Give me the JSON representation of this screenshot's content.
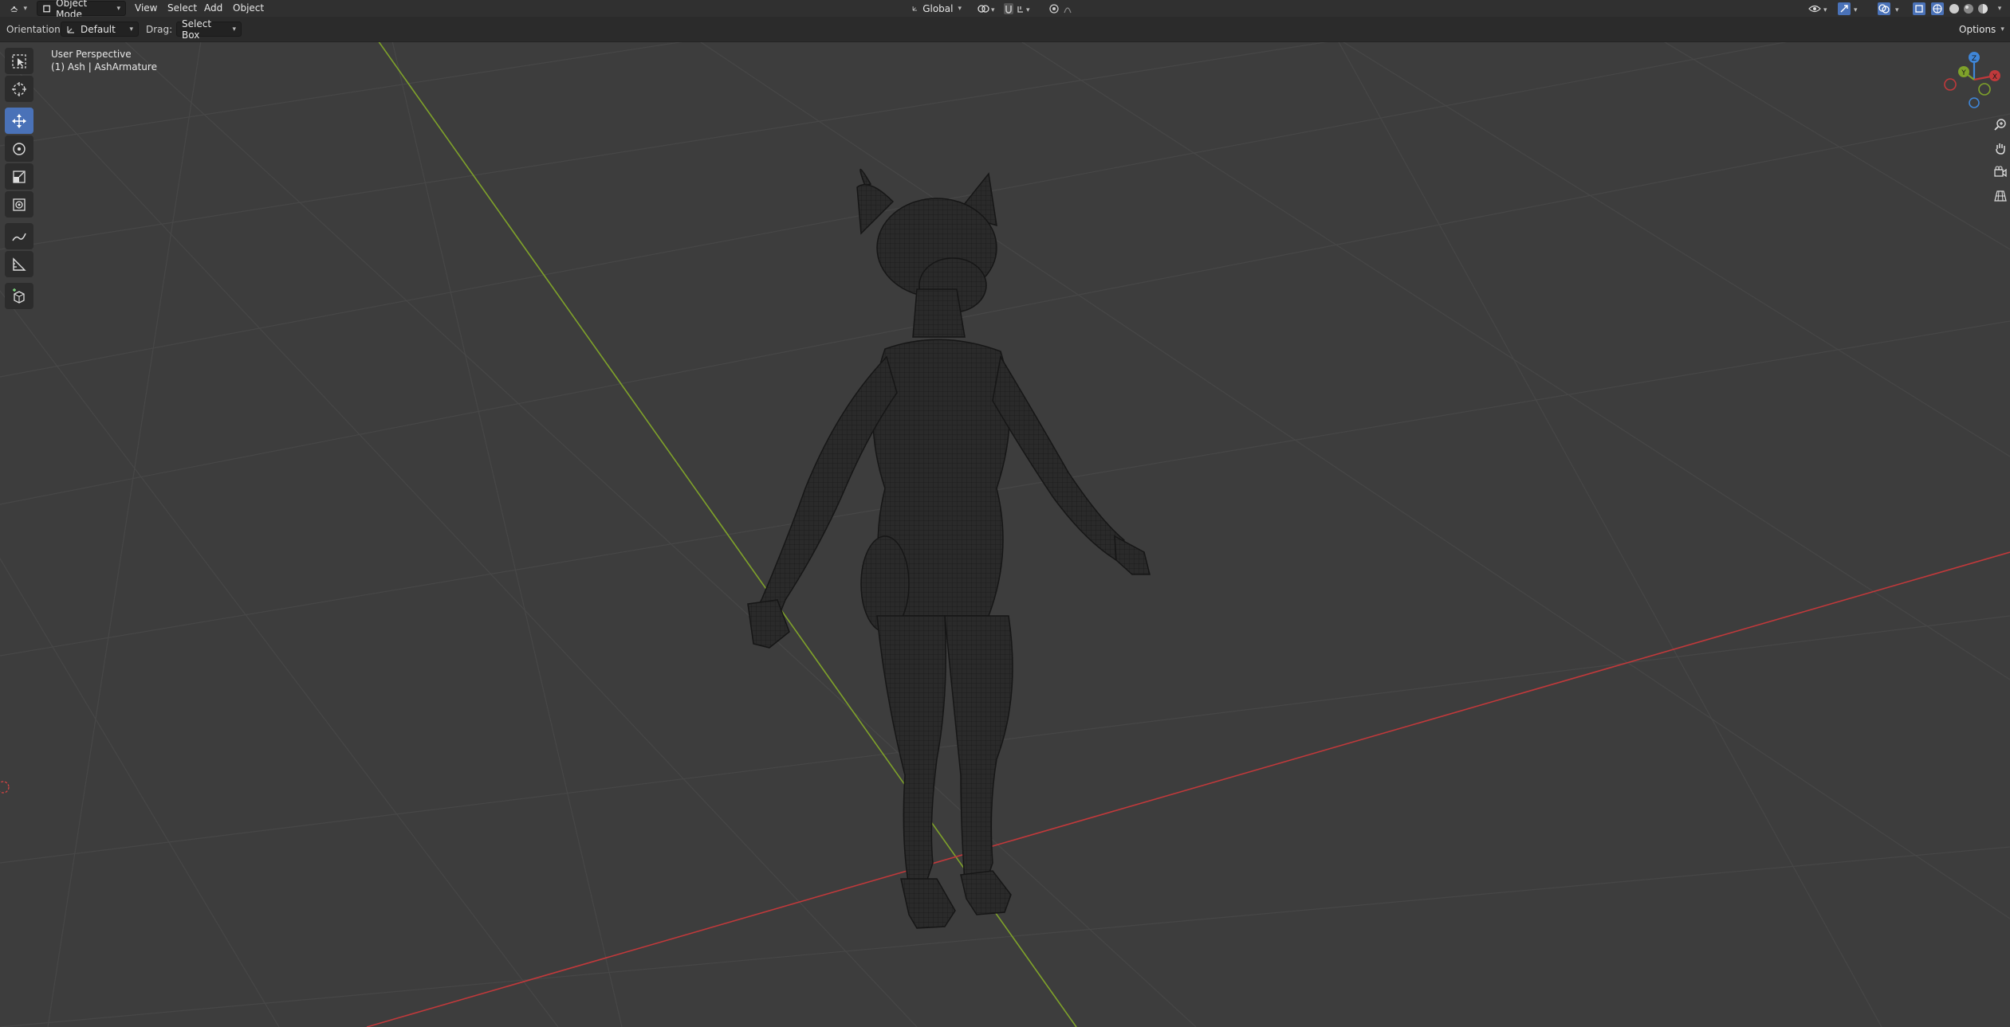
{
  "header": {
    "editor_type_icon": "3d-viewport-icon",
    "mode": "Object Mode",
    "menus": [
      "View",
      "Select",
      "Add",
      "Object"
    ],
    "transform_orientation": "Global",
    "options_label": "Options"
  },
  "tool_header": {
    "orientation_label": "Orientation:",
    "orientation_value": "Default",
    "drag_label": "Drag:",
    "drag_value": "Select Box"
  },
  "viewport": {
    "perspective_label": "User Perspective",
    "object_label": "(1) Ash | AshArmature",
    "axes": {
      "x_color": "#c0393b",
      "y_color": "#7fa22a",
      "z_color": "#3f86d8"
    },
    "background": "#3d3d3d"
  },
  "toolbar": {
    "items": [
      {
        "name": "select-box-tool-icon",
        "active": false
      },
      {
        "name": "cursor-tool-icon",
        "active": false
      },
      {
        "name": "move-tool-icon",
        "active": true
      },
      {
        "name": "rotate-tool-icon",
        "active": false
      },
      {
        "name": "scale-tool-icon",
        "active": false
      },
      {
        "name": "transform-tool-icon",
        "active": false
      },
      {
        "name": "annotate-tool-icon",
        "active": false
      },
      {
        "name": "measure-tool-icon",
        "active": false
      },
      {
        "name": "add-cube-tool-icon",
        "active": false
      }
    ]
  },
  "gizmo": {
    "x_label": "X",
    "y_label": "Y",
    "z_label": "Z"
  },
  "navigation": [
    "zoom-icon",
    "pan-hand-icon",
    "camera-icon",
    "perspective-grid-icon"
  ]
}
